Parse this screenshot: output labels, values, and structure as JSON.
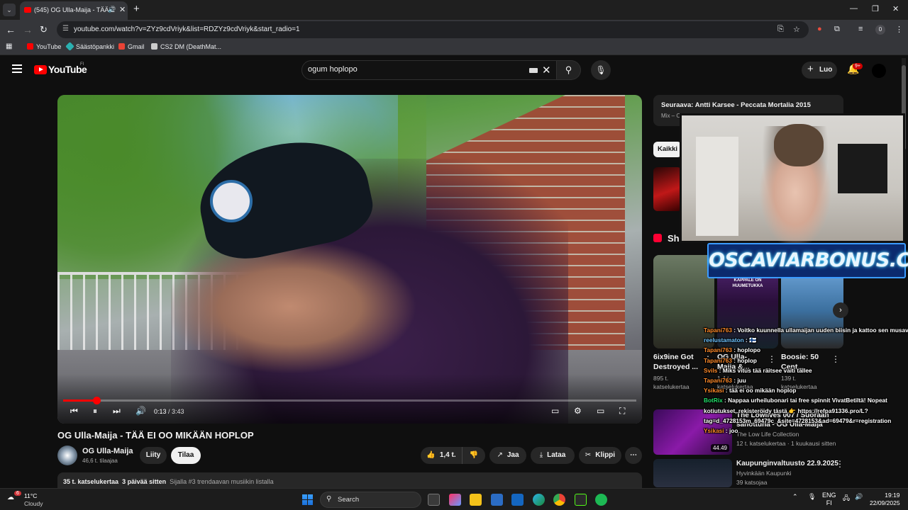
{
  "browser": {
    "tab_title": "(545) OG Ulla-Maija - TÄÄ E",
    "url": "youtube.com/watch?v=ZYz9cdVriyk&list=RDZYz9cdVriyk&start_radio=1",
    "profile_initial": "0",
    "bookmarks": [
      {
        "label": "YouTube",
        "color": "#ff0000"
      },
      {
        "label": "Säästöpankki",
        "color": "#2ab0b0"
      },
      {
        "label": "Gmail",
        "color": "#ea4335"
      },
      {
        "label": "CS2 DM (DeathMat...",
        "color": "#cccccc"
      }
    ]
  },
  "youtube": {
    "logo_text": "YouTube",
    "logo_region": "FI",
    "search_value": "ogum hoplopo",
    "create_label": "Luo",
    "notifications_badge": "9+"
  },
  "player": {
    "current_time": "0:13",
    "duration": "3:43",
    "progress_fraction": 0.058
  },
  "video": {
    "title": "OG Ulla-Maija - TÄÄ EI OO MIKÄÄN HOPLOP",
    "channel": "OG Ulla-Maija",
    "subscribers": "46,6 t. tilaajaa",
    "join_label": "Liity",
    "subscribe_label": "Tilaa",
    "likes": "1,4 t.",
    "share_label": "Jaa",
    "download_label": "Lataa",
    "clip_label": "Klippi",
    "views": "35 t. katselukertaa",
    "age": "3 päivää sitten",
    "trending": "Sijalla #3 trendaavan musiikin listalla"
  },
  "sidebar": {
    "up_next_title": "Seuraava: Antti Karsee - Peccata Mortalia 2015",
    "up_next_sub": "Mix – OG Ulla-Maija",
    "chip_all": "Kaikki",
    "shorts_label": "Sh",
    "shorts": [
      {
        "title": "6ix9ine Got Destroyed ...",
        "views": "895 t. katselukertaa"
      },
      {
        "title": "OG Ulla-Maija &...",
        "views": "1,4 t. katselukertaa",
        "overlay": "JOS TUNNETUMPI KAPPALE ON HUUMETUKKA"
      },
      {
        "title": "Boosie: 50 Cent...",
        "views": "139 t. katselukertaa"
      }
    ],
    "videos": [
      {
        "title": "The Lowlives 007 / Suoraan sanottuna - OG Ulla-Maija",
        "channel": "The Low Life Collection",
        "meta": "12 t. katselukertaa · 1 kuukausi sitten",
        "duration": "44.49"
      },
      {
        "title": "Kaupunginvaltuusto 22.9.2025",
        "channel": "Hyvinkään Kaupunki",
        "meta": "39 katsojaa",
        "duration": ""
      }
    ]
  },
  "overlay": {
    "brand": "OSCAVIARBONUS.COM",
    "chat": [
      {
        "user": "Tapani763",
        "msg": "Voitko kuunnella ullamaijan uuden biisin ja kattoo sen musavideon",
        "color": "orange"
      },
      {
        "user": "reelustamaton",
        "msg": "🇫🇮",
        "color": "blue"
      },
      {
        "user": "Tapani763",
        "msg": "hoplopo",
        "color": "orange"
      },
      {
        "user": "Tapani763",
        "msg": "hoplop",
        "color": "orange"
      },
      {
        "user": "Svils",
        "msg": "Miks vitus tää räitsee vaiti tällee",
        "color": "orange"
      },
      {
        "user": "Tapani763",
        "msg": "juu",
        "color": "orange"
      },
      {
        "user": "Ysikasi",
        "msg": "tää ei oo mikään hoplop",
        "color": "orange"
      },
      {
        "user": "BotRix",
        "msg": "Nappaa urheilubonari tai free spinnit VivatBetiltä! Nopeat",
        "color": "green"
      },
      {
        "user": "",
        "msg": "kotiutukset, rekisteröidy tästä 👉 https://refpa91336.pro/L?",
        "color": "green"
      },
      {
        "user": "",
        "msg": "tag=d_4728153m_69479c_&site=4728153&ad=69479&r=registration",
        "color": "green"
      },
      {
        "user": "Ysikasi",
        "msg": "joo",
        "color": "orange"
      }
    ]
  },
  "taskbar": {
    "weather_badge": "6",
    "temperature": "11°C",
    "condition": "Cloudy",
    "search_label": "Search",
    "lang": "ENG",
    "region": "FI",
    "time": "19:19",
    "date": "22/09/2025"
  }
}
